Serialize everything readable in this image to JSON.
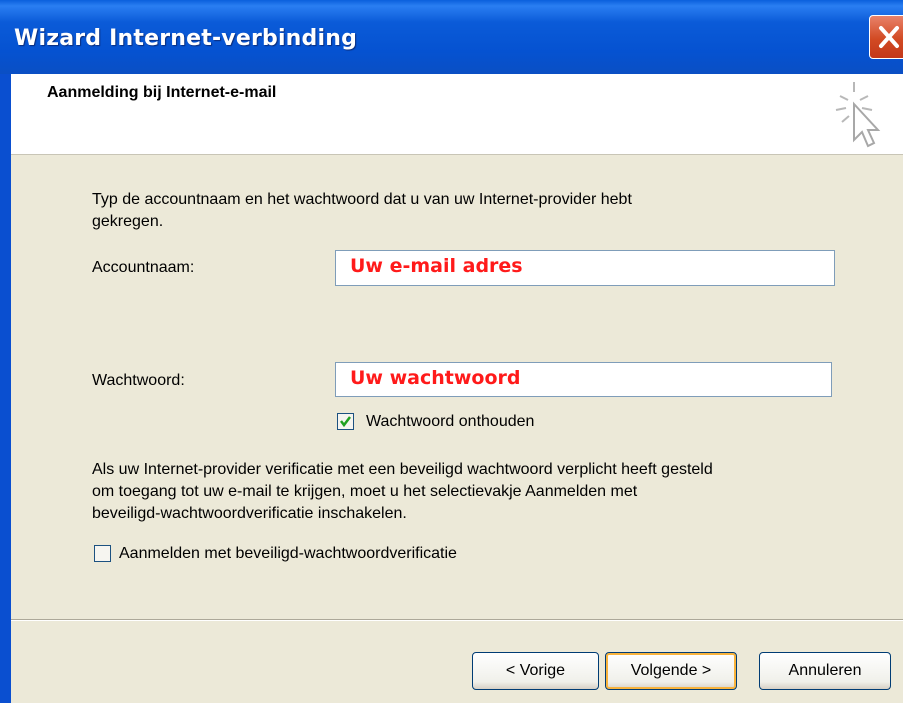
{
  "window": {
    "title": "Wizard Internet-verbinding"
  },
  "header": {
    "title": "Aanmelding bij Internet-e-mail"
  },
  "content": {
    "intro_line1": "Typ de accountnaam en het wachtwoord dat u van uw Internet-provider hebt",
    "intro_line2": "gekregen.",
    "account_label": "Accountnaam:",
    "account_value": "Uw e-mail adres",
    "password_label": "Wachtwoord:",
    "password_value": "Uw wachtwoord",
    "remember_password_label": "Wachtwoord onthouden",
    "remember_password_checked": true,
    "spa_line1": "Als uw Internet-provider verificatie met een beveiligd wachtwoord verplicht heeft gesteld",
    "spa_line2": "om toegang tot uw e-mail te krijgen, moet u het selectievakje Aanmelden met",
    "spa_line3": "beveiligd-wachtwoordverificatie inschakelen.",
    "spa_checkbox_label": "Aanmelden met beveiligd-wachtwoordverificatie",
    "spa_checked": false
  },
  "buttons": {
    "back": "< Vorige",
    "next": "Volgende >",
    "cancel": "Annuleren"
  },
  "colors": {
    "accent_red": "#ff1a1a",
    "titlebar_blue": "#0552d1",
    "dialog_bg": "#ece9d8"
  }
}
